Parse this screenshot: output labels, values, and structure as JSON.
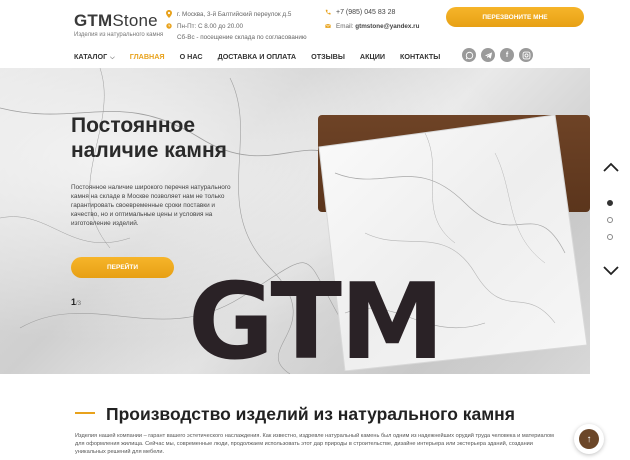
{
  "header": {
    "logo_brand": "GTM",
    "logo_stone": "Stone",
    "logo_sub": "Изделия из натурального камня",
    "address": "г. Москва, 3-й Балтийский переулок д.5",
    "hours": "Пн-Пт: С 8.00 до 20.00",
    "hours_note": "Сб-Вс - посещение склада по согласованию",
    "phone": "+7 (985) 045 83 28",
    "email_label": "Email:",
    "email": "gtmstone@yandex.ru",
    "callback_label": "ПЕРЕЗВОНИТЕ МНЕ",
    "accent_color": "#e8a21c"
  },
  "nav": {
    "items": [
      {
        "label": "КАТАЛОГ"
      },
      {
        "label": "ГЛАВНАЯ"
      },
      {
        "label": "О НАС"
      },
      {
        "label": "ДОСТАВКА И ОПЛАТА"
      },
      {
        "label": "ОТЗЫВЫ"
      },
      {
        "label": "АКЦИИ"
      },
      {
        "label": "КОНТАКТЫ"
      }
    ],
    "active": "ГЛАВНАЯ",
    "social_icons": [
      "whatsapp-icon",
      "telegram-icon",
      "facebook-icon",
      "instagram-icon"
    ]
  },
  "hero": {
    "title_line1": "Постоянное",
    "title_line2": "наличие камня",
    "text": "Постоянное наличие широкого перечня натурального камня на складе в Москве позволяет нам не только гарантировать своевременные сроки поставки и качество, но и оптимальные цены и условия на изготовление изделий.",
    "button_label": "ПЕРЕЙТИ",
    "slide_current": "1",
    "slide_total": "/3",
    "big_text": "GTM"
  },
  "section": {
    "title": "Производство изделий из натурального камня",
    "text": "Изделия нашей компании – гарант вашего эстетического наслаждения. Как известно, издревле натуральный камень был одним из надежнейших орудий труда человека и материалом для оформления жилища. Сейчас мы, современные люди, продолжаем использовать этот дар природы в строительстве, дизайне интерьера или экстерьера зданий, создании уникальных решений для мебели."
  }
}
